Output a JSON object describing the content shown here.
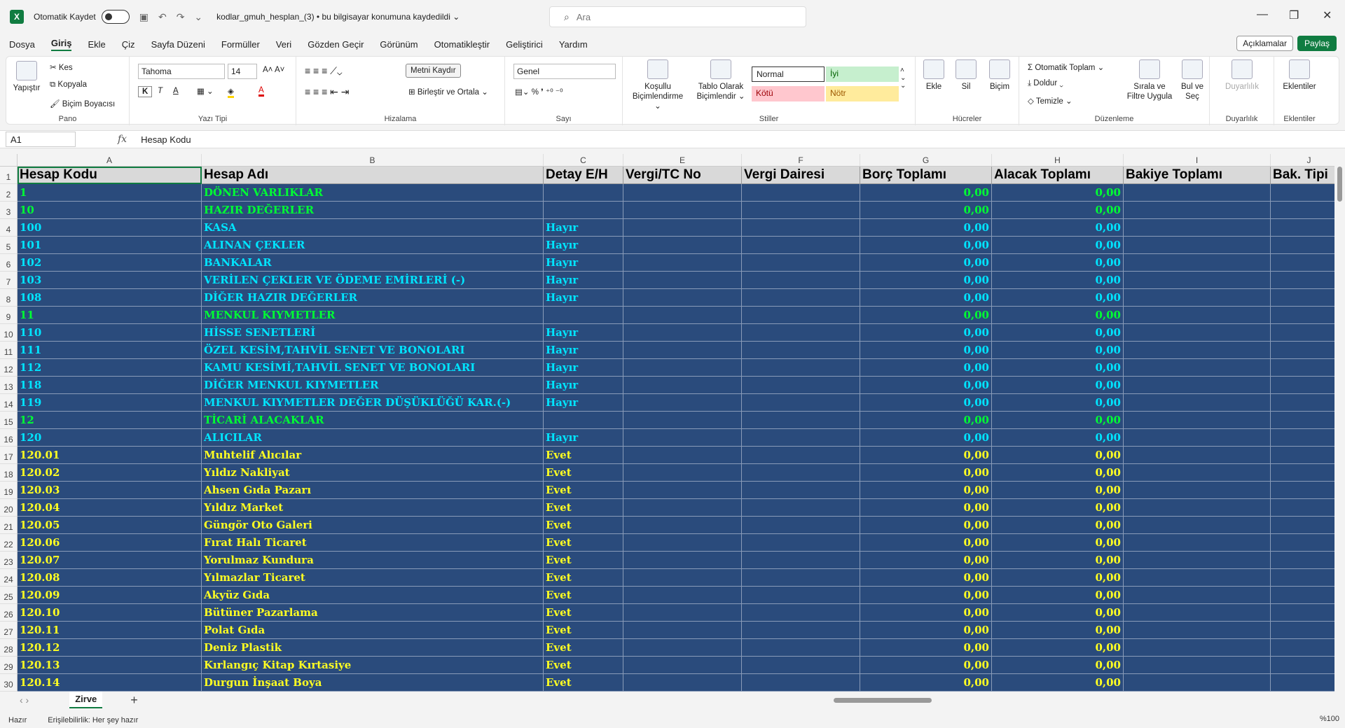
{
  "titlebar": {
    "autosave_label": "Otomatik Kaydet",
    "doc_title": "kodlar_gmuh_hesplan_(3)  •  bu bilgisayar konumuna kaydedildi ⌄",
    "search_placeholder": "Ara"
  },
  "menu": [
    "Dosya",
    "Giriş",
    "Ekle",
    "Çiz",
    "Sayfa Düzeni",
    "Formüller",
    "Veri",
    "Gözden Geçir",
    "Görünüm",
    "Otomatikleştir",
    "Geliştirici",
    "Yardım"
  ],
  "menu_active": "Giriş",
  "share": {
    "comments": "Açıklamalar",
    "share": "Paylaş"
  },
  "ribbon": {
    "pano": {
      "label": "Pano",
      "paste": "Yapıştır",
      "cut": "Kes",
      "copy": "Kopyala",
      "format_painter": "Biçim Boyacısı"
    },
    "font": {
      "label": "Yazı Tipi",
      "name": "Tahoma",
      "size": "14",
      "bold": "K",
      "italic": "T",
      "underline": "A"
    },
    "align": {
      "label": "Hizalama",
      "wrap": "Metni Kaydır",
      "merge": "Birleştir ve Ortala"
    },
    "number": {
      "label": "Sayı",
      "format": "Genel"
    },
    "styles": {
      "label": "Stiller",
      "cond": "Koşullu Biçimlendirme ⌄",
      "table": "Tablo Olarak Biçimlendir ⌄",
      "normal": "Normal",
      "good": "İyi",
      "bad": "Kötü",
      "neutral": "Nötr"
    },
    "cells": {
      "label": "Hücreler",
      "insert": "Ekle",
      "delete": "Sil",
      "format": "Biçim"
    },
    "editing": {
      "label": "Düzenleme",
      "autosum": "Otomatik Toplam",
      "fill": "Doldur",
      "clear": "Temizle",
      "sort": "Sırala ve Filtre Uygula",
      "find": "Bul ve Seç"
    },
    "sensitivity": {
      "label": "Duyarlılık",
      "btn": "Duyarlılık"
    },
    "addins": {
      "label": "Eklentiler",
      "btn": "Eklentiler"
    }
  },
  "formula_bar": {
    "namebox": "A1",
    "content": "Hesap Kodu"
  },
  "columns": [
    "A",
    "B",
    "C",
    "E",
    "F",
    "G",
    "H",
    "I",
    "J"
  ],
  "headers": [
    "Hesap Kodu",
    "Hesap Adı",
    "Detay E/H",
    "Vergi/TC No",
    "Vergi Dairesi",
    "Borç Toplamı",
    "Alacak Toplamı",
    "Bakiye Toplamı",
    "Bak. Tipi"
  ],
  "rows": [
    {
      "n": "2",
      "code": "1",
      "name": "DÖNEN VARLIKLAR",
      "detay": "",
      "borc": "0,00",
      "alacak": "0,00",
      "color": "green"
    },
    {
      "n": "3",
      "code": "10",
      "name": "HAZIR DEĞERLER",
      "detay": "",
      "borc": "0,00",
      "alacak": "0,00",
      "color": "green"
    },
    {
      "n": "4",
      "code": "100",
      "name": "KASA",
      "detay": "Hayır",
      "borc": "0,00",
      "alacak": "0,00",
      "color": "cyan"
    },
    {
      "n": "5",
      "code": "101",
      "name": "ALINAN ÇEKLER",
      "detay": "Hayır",
      "borc": "0,00",
      "alacak": "0,00",
      "color": "cyan"
    },
    {
      "n": "6",
      "code": "102",
      "name": "BANKALAR",
      "detay": "Hayır",
      "borc": "0,00",
      "alacak": "0,00",
      "color": "cyan"
    },
    {
      "n": "7",
      "code": "103",
      "name": "VERİLEN ÇEKLER VE ÖDEME EMİRLERİ (-)",
      "detay": "Hayır",
      "borc": "0,00",
      "alacak": "0,00",
      "color": "cyan"
    },
    {
      "n": "8",
      "code": "108",
      "name": "DİĞER HAZIR DEĞERLER",
      "detay": "Hayır",
      "borc": "0,00",
      "alacak": "0,00",
      "color": "cyan"
    },
    {
      "n": "9",
      "code": "11",
      "name": "MENKUL KIYMETLER",
      "detay": "",
      "borc": "0,00",
      "alacak": "0,00",
      "color": "green"
    },
    {
      "n": "10",
      "code": "110",
      "name": "HİSSE SENETLERİ",
      "detay": "Hayır",
      "borc": "0,00",
      "alacak": "0,00",
      "color": "cyan"
    },
    {
      "n": "11",
      "code": "111",
      "name": "ÖZEL KESİM,TAHVİL SENET VE BONOLARI",
      "detay": "Hayır",
      "borc": "0,00",
      "alacak": "0,00",
      "color": "cyan"
    },
    {
      "n": "12",
      "code": "112",
      "name": "KAMU KESİMİ,TAHVİL SENET VE BONOLARI",
      "detay": "Hayır",
      "borc": "0,00",
      "alacak": "0,00",
      "color": "cyan"
    },
    {
      "n": "13",
      "code": "118",
      "name": "DİĞER MENKUL KIYMETLER",
      "detay": "Hayır",
      "borc": "0,00",
      "alacak": "0,00",
      "color": "cyan"
    },
    {
      "n": "14",
      "code": "119",
      "name": "MENKUL KIYMETLER DEĞER DÜŞÜKLÜĞÜ KAR.(-)",
      "detay": "Hayır",
      "borc": "0,00",
      "alacak": "0,00",
      "color": "cyan"
    },
    {
      "n": "15",
      "code": "12",
      "name": "TİCARİ ALACAKLAR",
      "detay": "",
      "borc": "0,00",
      "alacak": "0,00",
      "color": "green"
    },
    {
      "n": "16",
      "code": "120",
      "name": "ALICILAR",
      "detay": "Hayır",
      "borc": "0,00",
      "alacak": "0,00",
      "color": "cyan"
    },
    {
      "n": "17",
      "code": "120.01",
      "name": "Muhtelif Alıcılar",
      "detay": "Evet",
      "borc": "0,00",
      "alacak": "0,00",
      "color": "yellow"
    },
    {
      "n": "18",
      "code": "120.02",
      "name": "Yıldız Nakliyat",
      "detay": "Evet",
      "borc": "0,00",
      "alacak": "0,00",
      "color": "yellow"
    },
    {
      "n": "19",
      "code": "120.03",
      "name": "Ahsen Gıda Pazarı",
      "detay": "Evet",
      "borc": "0,00",
      "alacak": "0,00",
      "color": "yellow"
    },
    {
      "n": "20",
      "code": "120.04",
      "name": "Yıldız Market",
      "detay": "Evet",
      "borc": "0,00",
      "alacak": "0,00",
      "color": "yellow"
    },
    {
      "n": "21",
      "code": "120.05",
      "name": "Güngör Oto Galeri",
      "detay": "Evet",
      "borc": "0,00",
      "alacak": "0,00",
      "color": "yellow"
    },
    {
      "n": "22",
      "code": "120.06",
      "name": "Fırat Halı Ticaret",
      "detay": "Evet",
      "borc": "0,00",
      "alacak": "0,00",
      "color": "yellow"
    },
    {
      "n": "23",
      "code": "120.07",
      "name": "Yorulmaz Kundura",
      "detay": "Evet",
      "borc": "0,00",
      "alacak": "0,00",
      "color": "yellow"
    },
    {
      "n": "24",
      "code": "120.08",
      "name": "Yılmazlar Ticaret",
      "detay": "Evet",
      "borc": "0,00",
      "alacak": "0,00",
      "color": "yellow"
    },
    {
      "n": "25",
      "code": "120.09",
      "name": "Akyüz Gıda",
      "detay": "Evet",
      "borc": "0,00",
      "alacak": "0,00",
      "color": "yellow"
    },
    {
      "n": "26",
      "code": "120.10",
      "name": "Bütüner Pazarlama",
      "detay": "Evet",
      "borc": "0,00",
      "alacak": "0,00",
      "color": "yellow"
    },
    {
      "n": "27",
      "code": "120.11",
      "name": "Polat Gıda",
      "detay": "Evet",
      "borc": "0,00",
      "alacak": "0,00",
      "color": "yellow"
    },
    {
      "n": "28",
      "code": "120.12",
      "name": "Deniz Plastik",
      "detay": "Evet",
      "borc": "0,00",
      "alacak": "0,00",
      "color": "yellow"
    },
    {
      "n": "29",
      "code": "120.13",
      "name": "Kırlangıç Kitap Kırtasiye",
      "detay": "Evet",
      "borc": "0,00",
      "alacak": "0,00",
      "color": "yellow"
    },
    {
      "n": "30",
      "code": "120.14",
      "name": "Durgun İnşaat Boya",
      "detay": "Evet",
      "borc": "0,00",
      "alacak": "0,00",
      "color": "yellow"
    }
  ],
  "sheet_tab": "Zirve",
  "status": {
    "ready": "Hazır",
    "accessibility": "Erişilebilirlik: Her şey hazır",
    "zoom": "%100"
  }
}
